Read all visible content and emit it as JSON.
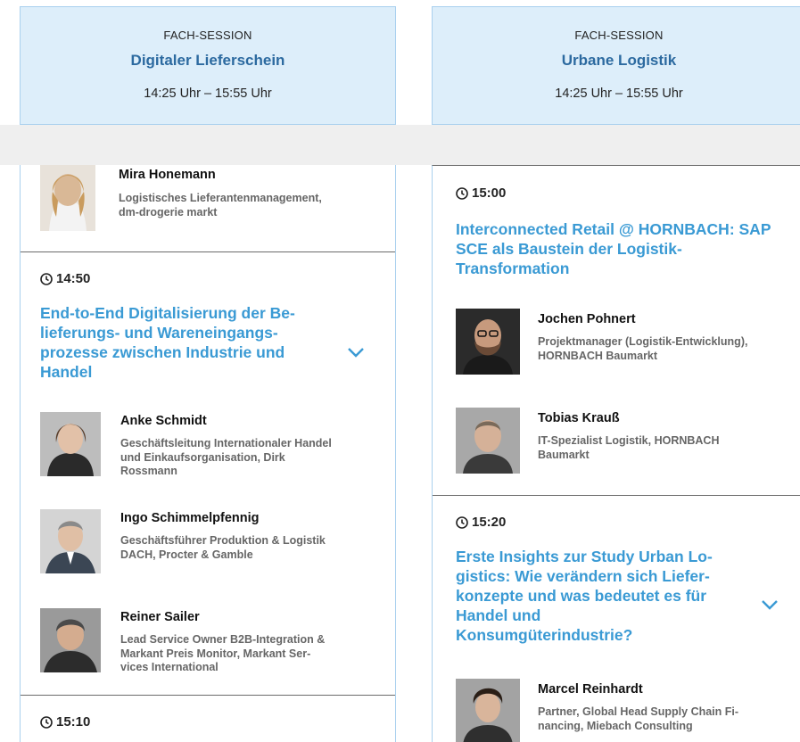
{
  "left_session": {
    "kind": "FACH-SESSION",
    "title": "Digitaler Lieferschein",
    "time": "14:25 Uhr – 15:55 Uhr",
    "top_speaker": {
      "name": "Mira Honemann",
      "role_lines": [
        "Logistisches Lieferantenmanagement,",
        "dm-drogerie markt"
      ]
    },
    "talk_1": {
      "time": "14:50",
      "title_lines": [
        "End-to-End Digitalisierung der Be-",
        "lieferungs- und Wareneingangs-",
        "prozesse zwischen Industrie und",
        "Handel"
      ],
      "speakers": [
        {
          "name": "Anke Schmidt",
          "role_lines": [
            "Geschäftsleitung Internationaler Handel",
            "und Einkaufsorganisation, Dirk",
            "Rossmann"
          ]
        },
        {
          "name": "Ingo Schimmelpfennig",
          "role_lines": [
            "Geschäftsführer Produktion & Logistik",
            "DACH, Procter & Gamble"
          ]
        },
        {
          "name": "Reiner Sailer",
          "role_lines": [
            "Lead Service Owner B2B-Integration &",
            "Markant Preis Monitor, Markant Ser-",
            "vices International"
          ]
        }
      ]
    },
    "talk_2": {
      "time": "15:10"
    }
  },
  "right_session": {
    "kind": "FACH-SESSION",
    "title": "Urbane Logistik",
    "time": "14:25 Uhr – 15:55 Uhr",
    "talk_1": {
      "time": "15:00",
      "title_lines": [
        "Interconnected Retail @ HORNBACH: SAP",
        "SCE als Baustein der Logistik-",
        "Transformation"
      ],
      "speakers": [
        {
          "name": "Jochen Pohnert",
          "role_lines": [
            "Projektmanager (Logistik-Entwicklung),",
            "HORNBACH Baumarkt"
          ]
        },
        {
          "name": "Tobias Krauß",
          "role_lines": [
            "IT-Spezialist Logistik, HORNBACH",
            "Baumarkt"
          ]
        }
      ]
    },
    "talk_2": {
      "time": "15:20",
      "title_lines": [
        "Erste Insights zur Study Urban Lo-",
        "gistics: Wie verändern sich Liefer-",
        "konzepte und was bedeutet es für",
        "Handel und",
        "Konsumgüterindustrie?"
      ],
      "speakers": [
        {
          "name": "Marcel Reinhardt",
          "role_lines": [
            "Partner, Global Head Supply Chain Fi-",
            "nancing, Miebach Consulting"
          ]
        }
      ]
    }
  },
  "icons": {
    "clock": "clock-icon",
    "expand": "chevron-down-icon"
  },
  "colors": {
    "header_bg": "#ddeefa",
    "header_border": "#a9d0ee",
    "session_title": "#2c6aa0",
    "talk_title": "#3a9ad4",
    "gap_bar": "#efefef"
  }
}
